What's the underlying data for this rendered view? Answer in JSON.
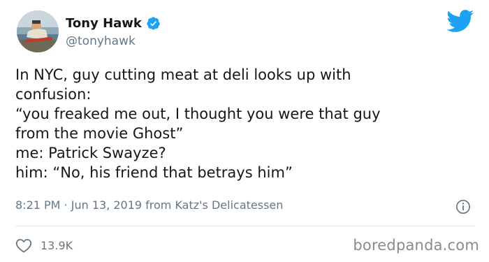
{
  "user": {
    "name": "Tony Hawk",
    "handle": "@tonyhawk"
  },
  "icons": {
    "brand": "twitter-bird-icon",
    "verified": "verified-badge-icon",
    "info": "info-icon",
    "like": "heart-icon"
  },
  "colors": {
    "brand": "#1DA1F2",
    "text": "#14171A",
    "secondary": "#657786",
    "divider": "#E1E8ED"
  },
  "tweet": {
    "lines": [
      "In NYC, guy cutting meat at deli looks up with",
      "confusion:",
      "“you freaked me out, I thought you were that guy",
      "from the movie Ghost”",
      "me: Patrick Swayze?",
      "him: “No, his friend that betrays him”"
    ],
    "timestamp": "8:21 PM · Jun 13, 2019 from Katz's Delicatessen",
    "likes": "13.9K"
  },
  "watermark": "boredpanda.com"
}
